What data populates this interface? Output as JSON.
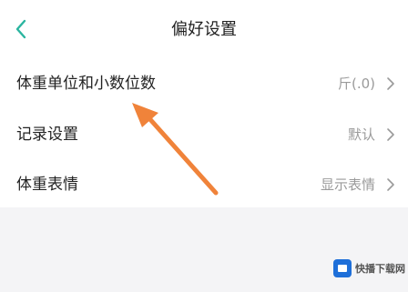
{
  "header": {
    "title": "偏好设置",
    "back_icon": "chevron-left-icon",
    "accent_color": "#2bb5a0"
  },
  "settings": [
    {
      "label": "体重单位和小数位数",
      "value": "斤(.0)"
    },
    {
      "label": "记录设置",
      "value": "默认"
    },
    {
      "label": "体重表情",
      "value": "显示表情"
    }
  ],
  "colors": {
    "annotation_arrow": "#f0833a",
    "page_background": "#f4f4f6",
    "panel_background": "#ffffff"
  },
  "watermark": {
    "text": "快播下载网",
    "logo_color": "#1e6fd9"
  }
}
